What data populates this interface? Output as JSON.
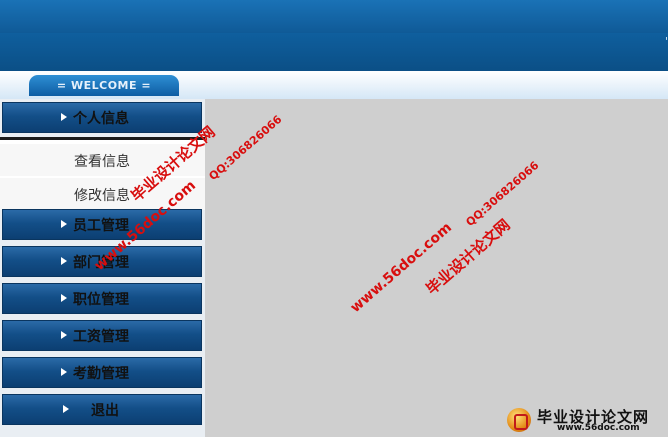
{
  "header": {
    "mark": "'"
  },
  "welcome": {
    "label": "= WELCOME ="
  },
  "menu": {
    "personal": "个人信息",
    "sub_items": [
      "查看信息",
      "修改信息"
    ],
    "employee": "员工管理",
    "department": "部门管理",
    "position": "职位管理",
    "salary": "工资管理",
    "attendance": "考勤管理",
    "logout": "退出"
  },
  "watermarks": {
    "site_name": "毕业设计论文网",
    "qq": "QQ:306826066",
    "url": "www.56doc.com"
  },
  "footer": {
    "brand": "毕业设计论文网",
    "url": "www.56doc.com"
  },
  "colors": {
    "header_blue": "#0f5a97",
    "menu_blue": "#134f88",
    "watermark_red": "#d80e0e",
    "content_gray": "#cfcfcf"
  }
}
